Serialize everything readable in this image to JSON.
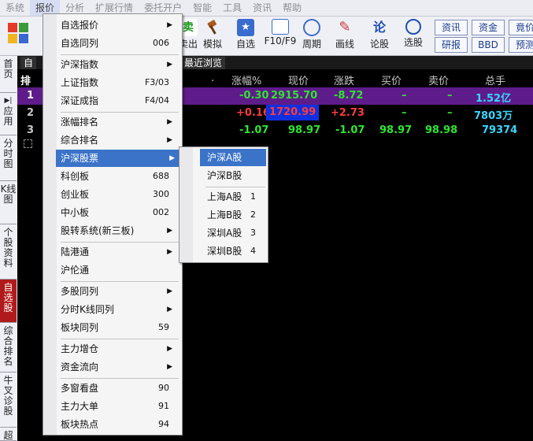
{
  "menubar": [
    "系统",
    "报价",
    "分析",
    "扩展行情",
    "委托开户",
    "智能",
    "工具",
    "资讯",
    "帮助"
  ],
  "toolbar": {
    "items": [
      {
        "label": "卖出",
        "icon": "sell-icon"
      },
      {
        "label": "模拟",
        "icon": "gavel-icon"
      },
      {
        "label": "自选",
        "icon": "star-folder-icon"
      },
      {
        "label": "F10/F9",
        "icon": "f10-icon"
      },
      {
        "label": "周期",
        "icon": "clock-icon"
      },
      {
        "label": "画线",
        "icon": "pencil-icon"
      },
      {
        "label": "论股",
        "icon": "discuss-icon"
      },
      {
        "label": "选股",
        "icon": "chart-search-icon"
      }
    ],
    "right_buttons": [
      "资讯",
      "资金",
      "竟价",
      "研报",
      "BBD",
      "预测"
    ]
  },
  "sidebar": [
    "首页",
    "应用",
    "分时图",
    "K线图",
    "个股资料",
    "自选股",
    "综合排名",
    "牛叉诊股",
    "超"
  ],
  "tabs": [
    "自",
    "最近浏览"
  ],
  "table": {
    "headers": [
      "排",
      "涨幅%",
      "现价",
      "涨跌",
      "买价",
      "卖价",
      "总手"
    ],
    "rows": [
      {
        "idx": "1",
        "pct": "-0.30",
        "price": "2915.70",
        "chg": "-8.72",
        "bid": "–",
        "ask": "–",
        "vol": "1.52亿"
      },
      {
        "idx": "2",
        "pct": "+0.16",
        "price": "1720.99",
        "chg": "+2.73",
        "bid": "–",
        "ask": "–",
        "vol": "7803万"
      },
      {
        "idx": "3",
        "pct": "-1.07",
        "price": "98.97",
        "chg": "-1.07",
        "bid": "98.97",
        "ask": "98.98",
        "vol": "79374"
      }
    ]
  },
  "menu": {
    "items": [
      {
        "label": "自选报价",
        "shortcut": "",
        "arrow": true
      },
      {
        "label": "自选同列",
        "shortcut": "006",
        "arrow": false
      },
      {
        "label": "沪深指数",
        "shortcut": "",
        "arrow": true
      },
      {
        "label": "上证指数",
        "shortcut": "F3/03",
        "arrow": false
      },
      {
        "label": "深证成指",
        "shortcut": "F4/04",
        "arrow": false
      },
      {
        "label": "涨幅排名",
        "shortcut": "",
        "arrow": true
      },
      {
        "label": "综合排名",
        "shortcut": "",
        "arrow": true
      },
      {
        "label": "沪深股票",
        "shortcut": "",
        "arrow": true
      },
      {
        "label": "科创板",
        "shortcut": "688",
        "arrow": false
      },
      {
        "label": "创业板",
        "shortcut": "300",
        "arrow": false
      },
      {
        "label": "中小板",
        "shortcut": "002",
        "arrow": false
      },
      {
        "label": "股转系统(新三板)",
        "shortcut": "",
        "arrow": true
      },
      {
        "label": "陆港通",
        "shortcut": "",
        "arrow": true
      },
      {
        "label": "沪伦通",
        "shortcut": "",
        "arrow": false
      },
      {
        "label": "多股同列",
        "shortcut": "",
        "arrow": true
      },
      {
        "label": "分时K线同列",
        "shortcut": "",
        "arrow": true
      },
      {
        "label": "板块同列",
        "shortcut": "59",
        "arrow": false
      },
      {
        "label": "主力增仓",
        "shortcut": "",
        "arrow": true
      },
      {
        "label": "资金流向",
        "shortcut": "",
        "arrow": true
      },
      {
        "label": "多窗看盘",
        "shortcut": "90",
        "arrow": false
      },
      {
        "label": "主力大单",
        "shortcut": "91",
        "arrow": false
      },
      {
        "label": "板块热点",
        "shortcut": "94",
        "arrow": false
      }
    ]
  },
  "submenu": {
    "items": [
      {
        "label": "沪深A股",
        "shortcut": ""
      },
      {
        "label": "沪深B股",
        "shortcut": ""
      },
      {
        "label": "上海A股",
        "shortcut": "1"
      },
      {
        "label": "上海B股",
        "shortcut": "2"
      },
      {
        "label": "深圳A股",
        "shortcut": "3"
      },
      {
        "label": "深圳B股",
        "shortcut": "4"
      }
    ]
  },
  "colors": {
    "highlight": "#3b73c8",
    "up": "#ff3b3b",
    "down": "#2ee62e",
    "row_selected": "#5e1c8a",
    "cyan": "#35d7ff"
  }
}
